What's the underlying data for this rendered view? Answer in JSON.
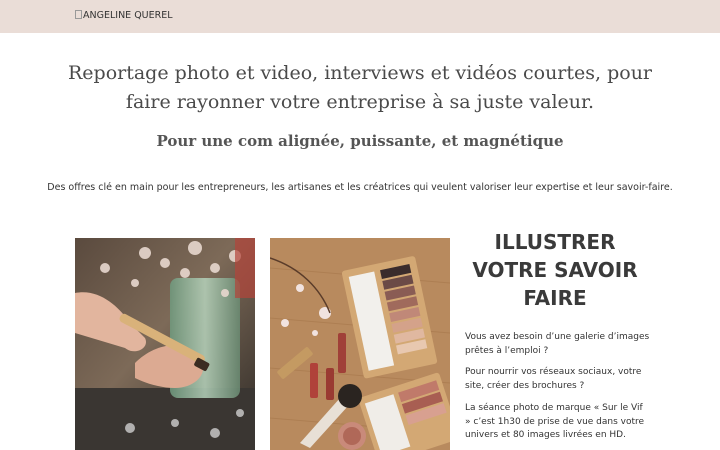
{
  "header": {
    "logo_alt": "ANGELINE QUEREL",
    "background": "#eaddd7"
  },
  "hero": {
    "title": "Reportage photo et video, interviews et vidéos courtes, pour faire rayonner votre entreprise à sa juste valeur.",
    "subtitle": "Pour une com alignée, puissante, et magnétique",
    "description": "Des offres clé en main pour les entrepreneurs, les artisanes et les créatrices qui veulent valoriser leur expertise et leur savoir-faire."
  },
  "section": {
    "heading": "ILLUSTRER VOTRE SAVOIR FAIRE",
    "paragraphs": [
      "Vous avez besoin d’une galerie d’images prêtes à l’emploi ?",
      "Pour nourrir vos réseaux sociaux, votre site, créer des brochures ?",
      "La séance photo de marque « Sur le Vif » c’est 1h30 de prise de vue dans votre univers et 80 images livrées en HD."
    ]
  },
  "images": [
    {
      "subject": "hands-cosmetic-pencil-photo"
    },
    {
      "subject": "makeup-palette-flatlay-photo"
    }
  ]
}
